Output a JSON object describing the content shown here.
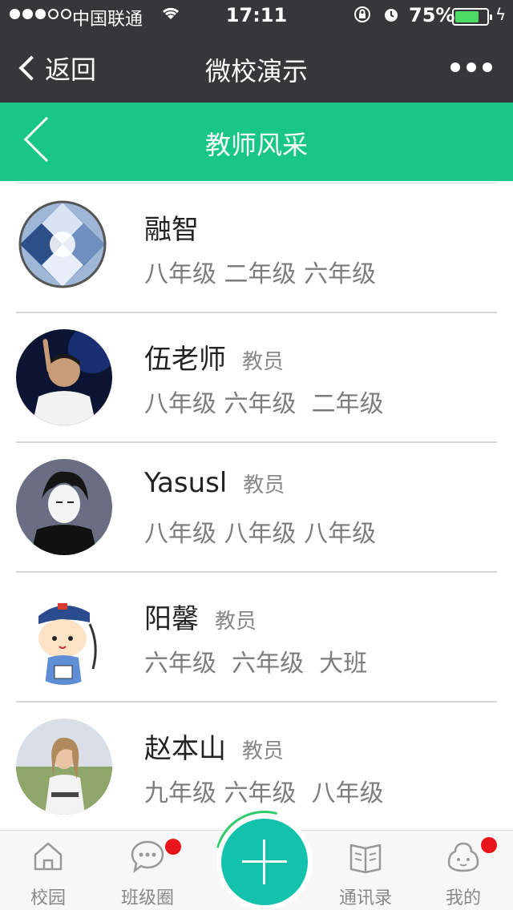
{
  "status_bar": {
    "carrier": "中国联通",
    "time": "17:11",
    "battery": "75%",
    "battery_level": 0.75
  },
  "nav": {
    "back_label": "返回",
    "title": "微校演示"
  },
  "page_header": {
    "title": "教师风采"
  },
  "teachers": [
    {
      "name": "融智",
      "role": "",
      "grades": "八年级 二年级 六年级",
      "avatar": "diamond"
    },
    {
      "name": "伍老师",
      "role": "教员",
      "grades": "八年级 六年级  二年级",
      "avatar": "man-on-stage"
    },
    {
      "name": "Yasusl",
      "role": "教员",
      "grades": "八年级 八年级 八年级",
      "avatar": "anime-boy"
    },
    {
      "name": "阳馨",
      "role": "教员",
      "grades": "六年级  六年级  大班",
      "avatar": "cartoon-character"
    },
    {
      "name": "赵本山",
      "role": "教员",
      "grades": "九年级 六年级  八年级",
      "avatar": "woman-in-field"
    }
  ],
  "tabbar": {
    "tabs": [
      {
        "label": "校园",
        "icon": "home-icon"
      },
      {
        "label": "班级圈",
        "icon": "chat-bubble-icon"
      },
      {
        "label": "通讯录",
        "icon": "book-icon"
      },
      {
        "label": "我的",
        "icon": "person-icon"
      }
    ],
    "badge_color": "#e8161b",
    "fab_color": "#13c2ad"
  },
  "colors": {
    "header_green": "#18c687",
    "topbar_dark": "#37373a"
  }
}
